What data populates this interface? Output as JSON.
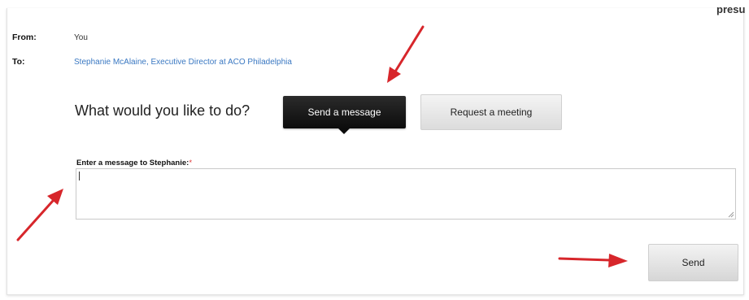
{
  "header": {
    "cut_text": "presu"
  },
  "from": {
    "label": "From:",
    "value": "You"
  },
  "to": {
    "label": "To:",
    "value": "Stephanie McAlaine, Executive Director at ACO Philadelphia"
  },
  "actions": {
    "question": "What would you like to do?",
    "send_message_label": "Send a message",
    "request_meeting_label": "Request a meeting"
  },
  "message": {
    "label": "Enter a message to Stephanie:",
    "required_mark": "*",
    "value": ""
  },
  "send_label": "Send",
  "annotations": {
    "arrow_color": "#d7262b"
  }
}
